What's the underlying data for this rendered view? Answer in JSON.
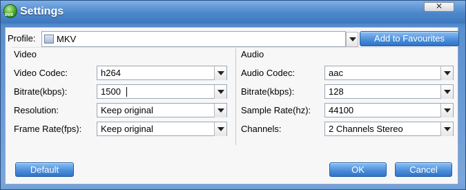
{
  "window": {
    "title": "Settings",
    "close_symbol": "✕"
  },
  "profile": {
    "label": "Profile:",
    "value": "MKV",
    "icon": "file-icon"
  },
  "buttons": {
    "add_favourites": "Add to Favourites",
    "default": "Default",
    "ok": "OK",
    "cancel": "Cancel"
  },
  "video": {
    "heading": "Video",
    "codec": {
      "label": "Video Codec:",
      "value": "h264"
    },
    "bitrate": {
      "label": "Bitrate(kbps):",
      "value": "1500"
    },
    "resolution": {
      "label": "Resolution:",
      "value": "Keep original"
    },
    "frame_rate": {
      "label": "Frame Rate(fps):",
      "value": "Keep original"
    }
  },
  "audio": {
    "heading": "Audio",
    "codec": {
      "label": "Audio Codec:",
      "value": "aac"
    },
    "bitrate": {
      "label": "Bitrate(kbps):",
      "value": "128"
    },
    "sample_rate": {
      "label": "Sample Rate(hz):",
      "value": "44100"
    },
    "channels": {
      "label": "Channels:",
      "value": "2 Channels Stereo"
    }
  }
}
